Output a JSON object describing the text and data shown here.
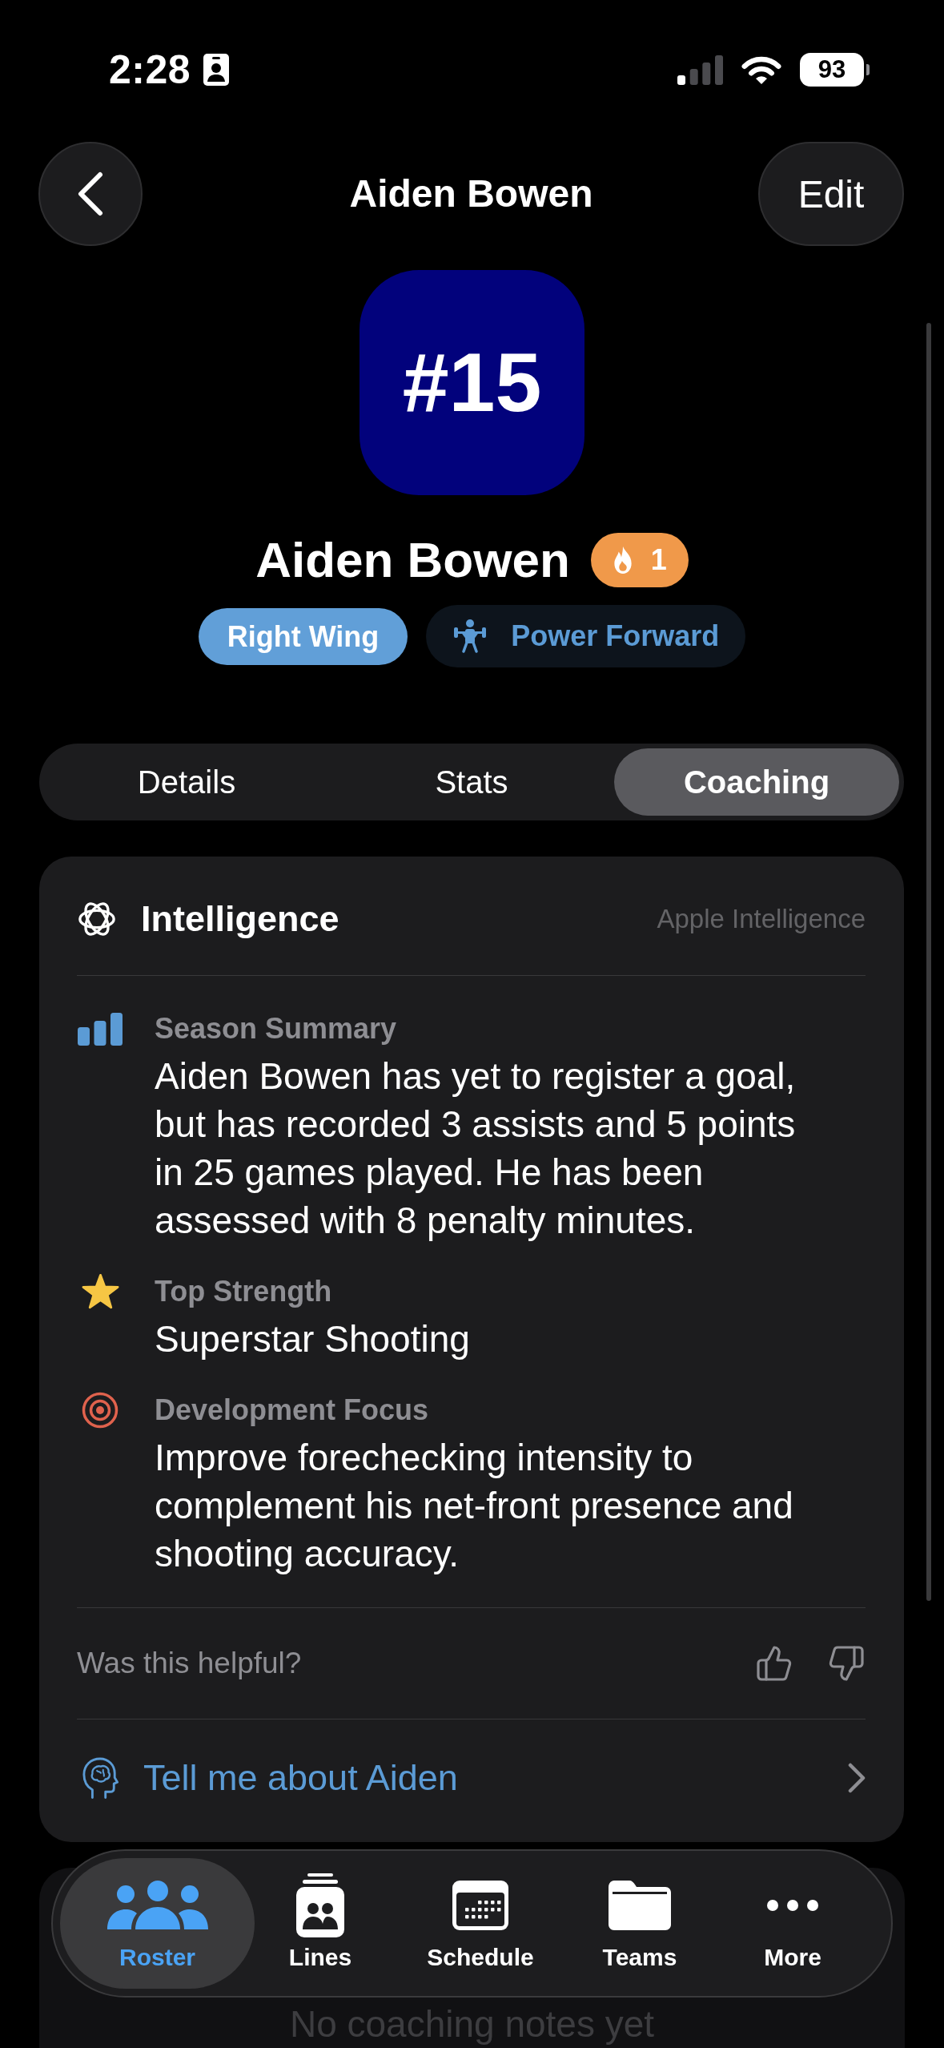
{
  "status_bar": {
    "time": "2:28",
    "battery": "93"
  },
  "nav": {
    "title": "Aiden Bowen",
    "edit": "Edit"
  },
  "player": {
    "number": "#15",
    "name": "Aiden Bowen",
    "streak": "1",
    "tags": [
      {
        "label": "Right Wing",
        "kind": "position"
      },
      {
        "label": "Power Forward",
        "kind": "role"
      }
    ]
  },
  "tabs": [
    {
      "label": "Details",
      "selected": false
    },
    {
      "label": "Stats",
      "selected": false
    },
    {
      "label": "Coaching",
      "selected": true
    }
  ],
  "intelligence_card": {
    "title": "Intelligence",
    "provider": "Apple Intelligence",
    "sections": [
      {
        "kind": "summary",
        "label": "Season Summary",
        "text": "Aiden Bowen has yet to register a goal, but has recorded 3 assists and 5 points in 25 games played. He has been assessed with 8 penalty minutes."
      },
      {
        "kind": "strength",
        "label": "Top Strength",
        "text": "Superstar Shooting"
      },
      {
        "kind": "focus",
        "label": "Development Focus",
        "text": "Improve forechecking intensity to complement his net-front presence and shooting accuracy."
      }
    ],
    "feedback": {
      "prompt": "Was this helpful?"
    },
    "ask": {
      "label": "Tell me about Aiden"
    }
  },
  "notes_card": {
    "empty_text": "No coaching notes yet"
  },
  "tab_bar": [
    {
      "label": "Roster",
      "kind": "roster",
      "selected": true
    },
    {
      "label": "Lines",
      "kind": "lines",
      "selected": false
    },
    {
      "label": "Schedule",
      "kind": "schedule",
      "selected": false
    },
    {
      "label": "Teams",
      "kind": "teams",
      "selected": false
    },
    {
      "label": "More",
      "kind": "more",
      "selected": false
    }
  ]
}
